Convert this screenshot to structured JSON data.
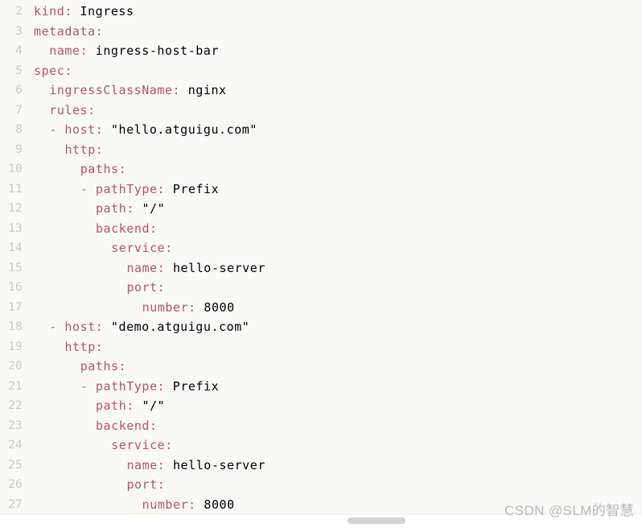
{
  "editor": {
    "language": "yaml",
    "background_color": "#f9f9f8",
    "gutter_color": "#c9c9c9",
    "colors": {
      "key": "#b5526e",
      "value": "#6d6d6d",
      "string": "#a6a23c",
      "number": "#6a8ec0",
      "dash": "#8d7f84"
    },
    "first_visible_line": 2,
    "last_visible_line": 27,
    "lines": [
      {
        "number": "2",
        "indent": 0,
        "tokens": [
          {
            "type": "key",
            "text": "kind"
          },
          {
            "type": "punct",
            "text": ":"
          },
          {
            "type": "plain",
            "text": " "
          },
          {
            "type": "value",
            "text": "Ingress"
          }
        ]
      },
      {
        "number": "3",
        "indent": 0,
        "tokens": [
          {
            "type": "key",
            "text": "metadata"
          },
          {
            "type": "punct",
            "text": ":"
          }
        ]
      },
      {
        "number": "4",
        "indent": 2,
        "tokens": [
          {
            "type": "key",
            "text": "name"
          },
          {
            "type": "punct",
            "text": ":"
          },
          {
            "type": "plain",
            "text": " "
          },
          {
            "type": "value",
            "text": "ingress-host-bar"
          }
        ]
      },
      {
        "number": "5",
        "indent": 0,
        "tokens": [
          {
            "type": "key",
            "text": "spec"
          },
          {
            "type": "punct",
            "text": ":"
          }
        ]
      },
      {
        "number": "6",
        "indent": 2,
        "tokens": [
          {
            "type": "key",
            "text": "ingressClassName"
          },
          {
            "type": "punct",
            "text": ":"
          },
          {
            "type": "plain",
            "text": " "
          },
          {
            "type": "value",
            "text": "nginx"
          }
        ]
      },
      {
        "number": "7",
        "indent": 2,
        "tokens": [
          {
            "type": "key",
            "text": "rules"
          },
          {
            "type": "punct",
            "text": ":"
          }
        ]
      },
      {
        "number": "8",
        "indent": 2,
        "tokens": [
          {
            "type": "dash",
            "text": "- "
          },
          {
            "type": "key",
            "text": "host"
          },
          {
            "type": "punct",
            "text": ":"
          },
          {
            "type": "plain",
            "text": " "
          },
          {
            "type": "string",
            "text": "\"hello.atguigu.com\""
          }
        ]
      },
      {
        "number": "9",
        "indent": 4,
        "tokens": [
          {
            "type": "key",
            "text": "http"
          },
          {
            "type": "punct",
            "text": ":"
          }
        ]
      },
      {
        "number": "10",
        "indent": 6,
        "tokens": [
          {
            "type": "key",
            "text": "paths"
          },
          {
            "type": "punct",
            "text": ":"
          }
        ]
      },
      {
        "number": "11",
        "indent": 6,
        "tokens": [
          {
            "type": "dash",
            "text": "- "
          },
          {
            "type": "key",
            "text": "pathType"
          },
          {
            "type": "punct",
            "text": ":"
          },
          {
            "type": "plain",
            "text": " "
          },
          {
            "type": "value",
            "text": "Prefix"
          }
        ]
      },
      {
        "number": "12",
        "indent": 8,
        "tokens": [
          {
            "type": "key",
            "text": "path"
          },
          {
            "type": "punct",
            "text": ":"
          },
          {
            "type": "plain",
            "text": " "
          },
          {
            "type": "string",
            "text": "\"/\""
          }
        ]
      },
      {
        "number": "13",
        "indent": 8,
        "tokens": [
          {
            "type": "key",
            "text": "backend"
          },
          {
            "type": "punct",
            "text": ":"
          }
        ]
      },
      {
        "number": "14",
        "indent": 10,
        "tokens": [
          {
            "type": "key",
            "text": "service"
          },
          {
            "type": "punct",
            "text": ":"
          }
        ]
      },
      {
        "number": "15",
        "indent": 12,
        "tokens": [
          {
            "type": "key",
            "text": "name"
          },
          {
            "type": "punct",
            "text": ":"
          },
          {
            "type": "plain",
            "text": " "
          },
          {
            "type": "value",
            "text": "hello-server"
          }
        ]
      },
      {
        "number": "16",
        "indent": 12,
        "tokens": [
          {
            "type": "key",
            "text": "port"
          },
          {
            "type": "punct",
            "text": ":"
          }
        ]
      },
      {
        "number": "17",
        "indent": 14,
        "tokens": [
          {
            "type": "key",
            "text": "number"
          },
          {
            "type": "punct",
            "text": ":"
          },
          {
            "type": "plain",
            "text": " "
          },
          {
            "type": "number",
            "text": "8000"
          }
        ]
      },
      {
        "number": "18",
        "indent": 2,
        "tokens": [
          {
            "type": "dash",
            "text": "- "
          },
          {
            "type": "key",
            "text": "host"
          },
          {
            "type": "punct",
            "text": ":"
          },
          {
            "type": "plain",
            "text": " "
          },
          {
            "type": "string",
            "text": "\"demo.atguigu.com\""
          }
        ]
      },
      {
        "number": "19",
        "indent": 4,
        "tokens": [
          {
            "type": "key",
            "text": "http"
          },
          {
            "type": "punct",
            "text": ":"
          }
        ]
      },
      {
        "number": "20",
        "indent": 6,
        "tokens": [
          {
            "type": "key",
            "text": "paths"
          },
          {
            "type": "punct",
            "text": ":"
          }
        ]
      },
      {
        "number": "21",
        "indent": 6,
        "tokens": [
          {
            "type": "dash",
            "text": "- "
          },
          {
            "type": "key",
            "text": "pathType"
          },
          {
            "type": "punct",
            "text": ":"
          },
          {
            "type": "plain",
            "text": " "
          },
          {
            "type": "value",
            "text": "Prefix"
          }
        ]
      },
      {
        "number": "22",
        "indent": 8,
        "tokens": [
          {
            "type": "key",
            "text": "path"
          },
          {
            "type": "punct",
            "text": ":"
          },
          {
            "type": "plain",
            "text": " "
          },
          {
            "type": "string",
            "text": "\"/\""
          }
        ]
      },
      {
        "number": "23",
        "indent": 8,
        "tokens": [
          {
            "type": "key",
            "text": "backend"
          },
          {
            "type": "punct",
            "text": ":"
          }
        ]
      },
      {
        "number": "24",
        "indent": 10,
        "tokens": [
          {
            "type": "key",
            "text": "service"
          },
          {
            "type": "punct",
            "text": ":"
          }
        ]
      },
      {
        "number": "25",
        "indent": 12,
        "tokens": [
          {
            "type": "key",
            "text": "name"
          },
          {
            "type": "punct",
            "text": ":"
          },
          {
            "type": "plain",
            "text": " "
          },
          {
            "type": "value",
            "text": "hello-server"
          }
        ]
      },
      {
        "number": "26",
        "indent": 12,
        "tokens": [
          {
            "type": "key",
            "text": "port"
          },
          {
            "type": "punct",
            "text": ":"
          }
        ]
      },
      {
        "number": "27",
        "indent": 14,
        "tokens": [
          {
            "type": "key",
            "text": "number"
          },
          {
            "type": "punct",
            "text": ":"
          },
          {
            "type": "plain",
            "text": " "
          },
          {
            "type": "number",
            "text": "8000"
          }
        ]
      }
    ]
  },
  "scrollbar": {
    "orientation": "horizontal",
    "thumb_color": "#d3d3d3"
  },
  "watermark": {
    "text": "CSDN @SLM的智慧",
    "color": "#b9b9b9"
  }
}
